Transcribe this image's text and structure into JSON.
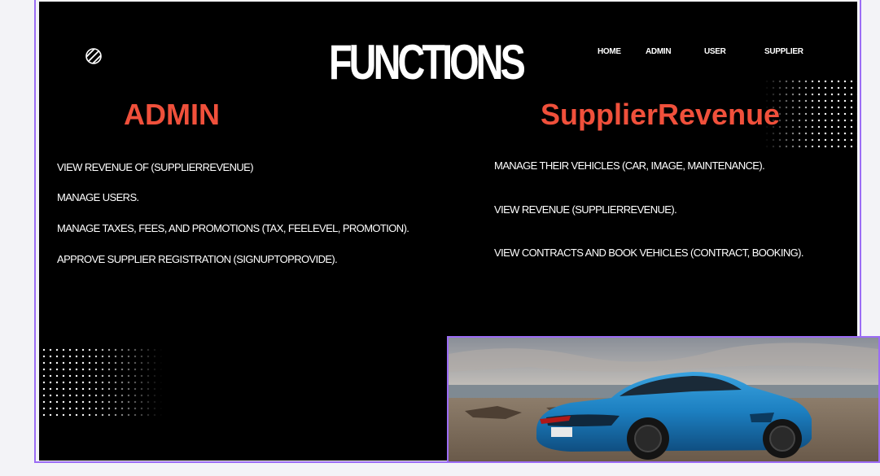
{
  "header": {
    "title": "FUNCTIONS",
    "logo_icon": "striped-circle-icon",
    "nav": [
      {
        "label": "HOME"
      },
      {
        "label": "ADMIN"
      },
      {
        "label": "USER"
      },
      {
        "label": "SUPPLIER"
      }
    ]
  },
  "sections": {
    "admin": {
      "heading": "ADMIN",
      "items": [
        "VIEW REVENUE OF (SUPPLIERREVENUE)",
        "MANAGE USERS.",
        "MANAGE TAXES, FEES, AND PROMOTIONS (TAX, FEELEVEL, PROMOTION).",
        "APPROVE SUPPLIER REGISTRATION (SIGNUPTOPROVIDE)."
      ]
    },
    "supplier": {
      "heading": "SupplierRevenue",
      "items": [
        "MANAGE THEIR VEHICLES (CAR, IMAGE, MAINTENANCE).",
        "VIEW REVENUE (SUPPLIERREVENUE).",
        "VIEW CONTRACTS AND BOOK VEHICLES (CONTRACT, BOOKING)."
      ]
    }
  },
  "colors": {
    "background": "#000000",
    "heading_accent": "#f0503b",
    "selection_outline": "#9b6cf5",
    "car_body": "#1e88c8"
  },
  "image": {
    "subject": "blue-sports-car-on-beach"
  }
}
